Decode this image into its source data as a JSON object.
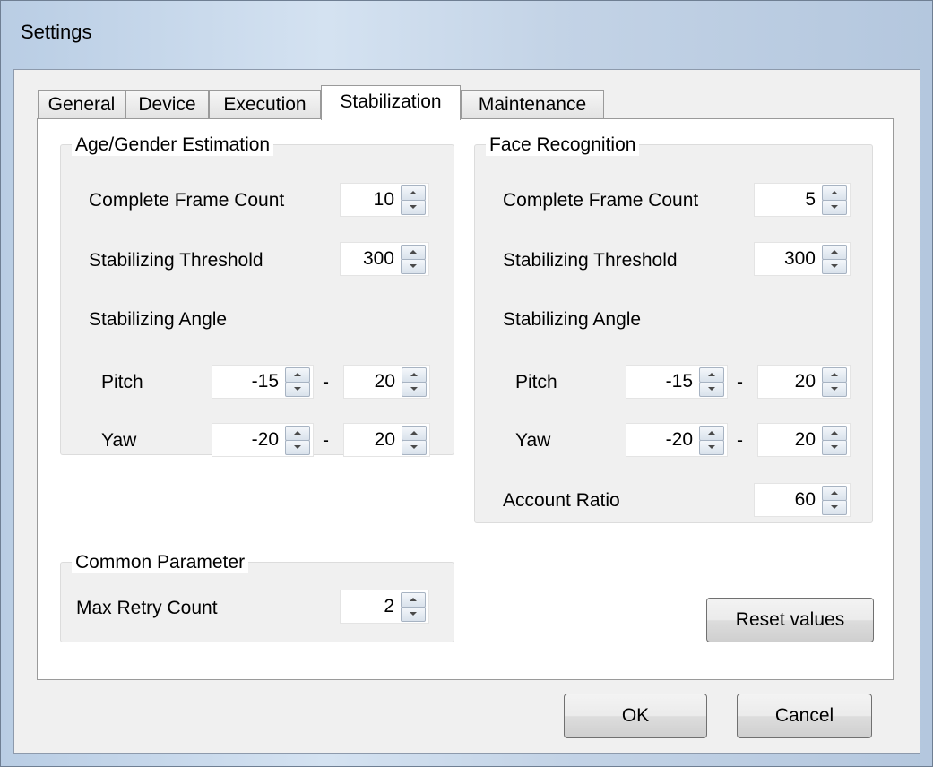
{
  "window": {
    "title": "Settings"
  },
  "tabs": [
    {
      "label": "General",
      "active": false
    },
    {
      "label": "Device",
      "active": false
    },
    {
      "label": "Execution",
      "active": false
    },
    {
      "label": "Stabilization",
      "active": true
    },
    {
      "label": "Maintenance",
      "active": false
    }
  ],
  "age_gender": {
    "title": "Age/Gender Estimation",
    "complete_frame_count": {
      "label": "Complete Frame Count",
      "value": "10"
    },
    "stabilizing_threshold": {
      "label": "Stabilizing Threshold",
      "value": "300"
    },
    "stabilizing_angle": {
      "label": "Stabilizing Angle"
    },
    "pitch": {
      "label": "Pitch",
      "min": "-15",
      "max": "20"
    },
    "yaw": {
      "label": "Yaw",
      "min": "-20",
      "max": "20"
    },
    "separator": "-"
  },
  "face_recognition": {
    "title": "Face Recognition",
    "complete_frame_count": {
      "label": "Complete Frame Count",
      "value": "5"
    },
    "stabilizing_threshold": {
      "label": "Stabilizing Threshold",
      "value": "300"
    },
    "stabilizing_angle": {
      "label": "Stabilizing Angle"
    },
    "pitch": {
      "label": "Pitch",
      "min": "-15",
      "max": "20"
    },
    "yaw": {
      "label": "Yaw",
      "min": "-20",
      "max": "20"
    },
    "account_ratio": {
      "label": "Account Ratio",
      "value": "60"
    },
    "separator": "-"
  },
  "common": {
    "title": "Common Parameter",
    "max_retry_count": {
      "label": "Max Retry Count",
      "value": "2"
    }
  },
  "buttons": {
    "reset": "Reset values",
    "ok": "OK",
    "cancel": "Cancel"
  }
}
